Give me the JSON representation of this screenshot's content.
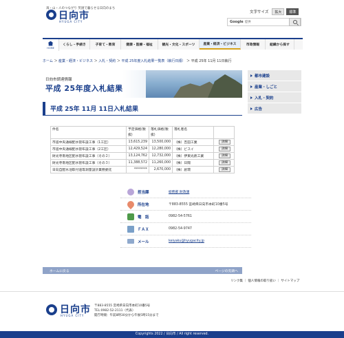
{
  "header": {
    "tagline": "海・山・人のつながり 笑顔で暮らせる日向のまち",
    "logo_text": "日向市",
    "logo_sub": "HYUGA CITY",
    "fontsize_label": "文字サイズ",
    "fontsize_large": "拡大",
    "fontsize_standard": "標準",
    "search_brand": "Google",
    "search_placeholder": "提供"
  },
  "gnav": {
    "home": "HOME",
    "items": [
      "くらし・手続き",
      "子育て・教育",
      "健康・医療・福祉",
      "観光・文化・スポーツ",
      "産業・経済・ビジネス",
      "市政情報",
      "組織から探す"
    ]
  },
  "breadcrumb": {
    "items": [
      "ホーム",
      "産業・経済・ビジネス",
      "入札・契約",
      "平成 25年度入札結果一覧表（執行日順）"
    ],
    "current": "平成 25年 11月 11日執行",
    "sep": " ＞ "
  },
  "banner": {
    "subtitle": "日向市調達情報",
    "title": "平成 25年度入札結果"
  },
  "side": {
    "items": [
      "都市建設",
      "産業・しごと",
      "入札・契約",
      "広告"
    ]
  },
  "page_title": "平成 25年 11月 11日入札結果",
  "table": {
    "headers": [
      "件名",
      "予定価格(税抜)",
      "落札価格(税抜)",
      "落札者名",
      ""
    ],
    "rows": [
      {
        "name": "市道中央通線配水管布設工事（1工区）",
        "pre": "13,615,239",
        "bid": "13,500,000",
        "co": "（株）吉田工業",
        "btn": "詳細"
      },
      {
        "name": "市道中央通線配水管布設工事（2工区）",
        "pre": "12,429,524",
        "bid": "12,280,000",
        "co": "（株）ビスイ",
        "btn": "詳細"
      },
      {
        "name": "財光寺南地区配水管布設工事（その２）",
        "pre": "13,124,762",
        "bid": "12,732,000",
        "co": "（株）伊東光熱工業",
        "btn": "詳細"
      },
      {
        "name": "財光寺南地区配水管布設工事（その３）",
        "pre": "11,388,572",
        "bid": "11,260,000",
        "co": "（株）日陽",
        "btn": "詳細"
      },
      {
        "name": "日向自配水池取付道等測量設計業務委託",
        "pre": "********",
        "bid": "2,670,000",
        "co": "（株）創環",
        "btn": "詳細"
      }
    ]
  },
  "contact": {
    "dept_label": "担当課",
    "dept_value": "総務部 財政課",
    "addr_label": "所在地",
    "addr_value": "〒883-8555 宮崎県日向市本町10番5号",
    "tel_label": "電　話",
    "tel_value": "0982-54-5761",
    "fax_label": "ＦＡＸ",
    "fax_value": "0982-54-9747",
    "mail_label": "メール",
    "mail_value": "keiyaku@hyugacity.jp"
  },
  "footer": {
    "back_home": "ホームに戻る",
    "back_top": "ページの先頭へ",
    "links": "リンク集 ｜ 個人情報の取り扱い ｜ サイトマップ",
    "logo_text": "日向市",
    "logo_sub": "HYUGA CITY",
    "addr1": "〒883-8555 宮崎県日向市本町10番5号",
    "addr2": "TEL:0982-52-2111（代表）",
    "addr3": "開庁時間：午前8時30分から午後5時15分まで",
    "copyright": "Copyrights 2022 / 日向市 / All right reserved."
  },
  "colors": {
    "brand": "#1a3f8c",
    "accent": "#d7a31a"
  }
}
